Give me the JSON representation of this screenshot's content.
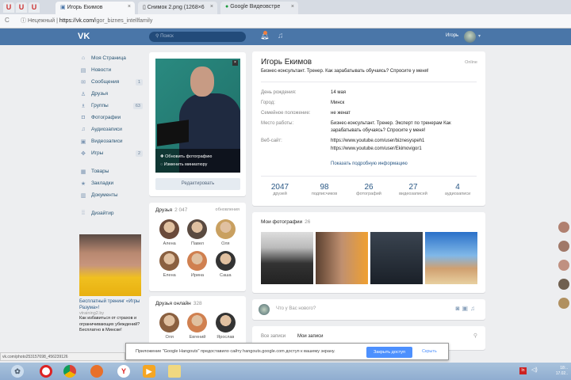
{
  "browser": {
    "tabs": [
      {
        "label": "Игорь Екимов",
        "active": true
      },
      {
        "label": "Снимок 2.png (1268×6"
      },
      {
        "label": "Google Видеовстре"
      }
    ],
    "secure_label": "Нецежный",
    "url_host": "https://vk.com/",
    "url_path": "igor_biznes_intellfamily",
    "status_url": "vk.com/photo253157698_456239126"
  },
  "header": {
    "logo": "VK",
    "search_placeholder": "Поиск",
    "user_name": "Игорь"
  },
  "menu": [
    {
      "label": "Моя Страница",
      "icon": "⌂"
    },
    {
      "label": "Новости",
      "icon": "▤"
    },
    {
      "label": "Сообщения",
      "icon": "✉",
      "count": "1"
    },
    {
      "label": "Друзья",
      "icon": "♙"
    },
    {
      "label": "Группы",
      "icon": "♗",
      "count": "63"
    },
    {
      "label": "Фотографии",
      "icon": "◘"
    },
    {
      "label": "Аудиозаписи",
      "icon": "♫"
    },
    {
      "label": "Видеозаписи",
      "icon": "▣"
    },
    {
      "label": "Игры",
      "icon": "✥",
      "count": "2"
    },
    {
      "label": "Товары",
      "icon": "▦"
    },
    {
      "label": "Закладки",
      "icon": "★"
    },
    {
      "label": "Документы",
      "icon": "▥"
    },
    {
      "label": "Дизайтир",
      "icon": "⁞⁞"
    }
  ],
  "ad": {
    "title": "Бесплатный тренинг «Игры Разума»!",
    "domain": "vtraining2.by",
    "text": "Как избавиться от страхов и ограничивающих убеждений? Бесплатно в Минске!"
  },
  "profile_photo": {
    "update": "Обновить фотографию",
    "thumb": "Изменить миниатюру",
    "edit_button": "Редактировать"
  },
  "friends": {
    "title": "Друзья",
    "count": "2 047",
    "updates": "обновления",
    "items": [
      "Алена",
      "Павел",
      "Оля",
      "Елена",
      "Ирина",
      "Саша"
    ]
  },
  "friends_online": {
    "title": "Друзья онлайн",
    "count": "328",
    "items": [
      "Оля",
      "Евгений",
      "Ярослав"
    ]
  },
  "profile": {
    "name": "Игорь Екимов",
    "online": "Online",
    "status": "Бизнес-консультант. Тренер. Как зарабатывать обучаясь? Спросите у меня!",
    "rows": [
      {
        "k": "День рождения:",
        "v": "14 мая"
      },
      {
        "k": "Город:",
        "v": "Минск"
      },
      {
        "k": "Семейное положение:",
        "v": "не женат"
      },
      {
        "k": "Место работы:",
        "v": "Бизнес-консультант. Тренер. Эксперт по тренерам Как зарабатывать обучаясь? Спросите у меня!"
      },
      {
        "k": "Веб-сайт:",
        "v": "https://www.youtube.com/user/biznesyspeh1"
      },
      {
        "k": "",
        "v": "https://www.youtube.com/user/Ekimovigor1"
      }
    ],
    "more": "Показать подробную информацию",
    "stats": [
      {
        "n": "2047",
        "l": "друзей"
      },
      {
        "n": "98",
        "l": "подписчиков"
      },
      {
        "n": "26",
        "l": "фотографий"
      },
      {
        "n": "27",
        "l": "видеозаписей"
      },
      {
        "n": "4",
        "l": "аудиозаписи"
      }
    ]
  },
  "photos": {
    "title": "Мои фотографии",
    "count": "26"
  },
  "post": {
    "placeholder": "Что у Вас нового?"
  },
  "wall": {
    "tab_all": "Все записи",
    "tab_mine": "Мои записи"
  },
  "hangouts": {
    "message": "Приложение \"Google Hangouts\" предоставило сайту hangouts.google.com доступ к вашему экрану.",
    "stop": "Закрыть доступ",
    "hide": "Скрыть"
  },
  "tray": {
    "time": "18:..",
    "date": "17.02.."
  }
}
